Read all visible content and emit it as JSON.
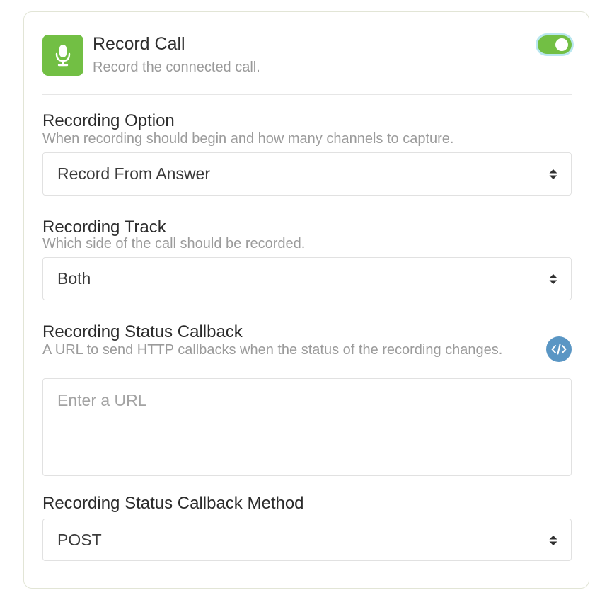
{
  "header": {
    "title": "Record Call",
    "subtitle": "Record the connected call.",
    "icon": "microphone-icon",
    "toggle_on": true
  },
  "fields": {
    "recording_option": {
      "label": "Recording Option",
      "help": "When recording should begin and how many channels to capture.",
      "value": "Record From Answer"
    },
    "recording_track": {
      "label": "Recording Track",
      "help": "Which side of the call should be recorded.",
      "value": "Both"
    },
    "recording_status_callback": {
      "label": "Recording Status Callback",
      "help": "A URL to send HTTP callbacks when the status of the recording changes.",
      "placeholder": "Enter a URL",
      "icon": "code-icon"
    },
    "recording_status_callback_method": {
      "label": "Recording Status Callback Method",
      "value": "POST"
    }
  },
  "colors": {
    "accent_green": "#72bf44",
    "code_blue": "#5a96c4",
    "toggle_ring": "#b9e7ef"
  }
}
